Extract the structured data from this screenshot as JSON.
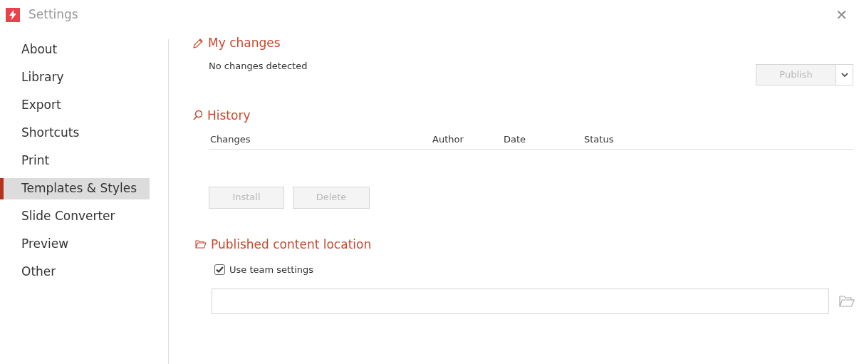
{
  "window": {
    "title": "Settings",
    "close": "✕"
  },
  "sidebar": {
    "items": [
      {
        "label": "About",
        "selected": false
      },
      {
        "label": "Library",
        "selected": false
      },
      {
        "label": "Export",
        "selected": false
      },
      {
        "label": "Shortcuts",
        "selected": false
      },
      {
        "label": "Print",
        "selected": false
      },
      {
        "label": "Templates & Styles",
        "selected": true
      },
      {
        "label": "Slide Converter",
        "selected": false
      },
      {
        "label": "Preview",
        "selected": false
      },
      {
        "label": "Other",
        "selected": false
      }
    ]
  },
  "my_changes": {
    "title": "My changes",
    "status": "No changes detected",
    "publish": {
      "label": "Publish",
      "disabled": true
    }
  },
  "history": {
    "title": "History",
    "columns": [
      "Changes",
      "Author",
      "Date",
      "Status"
    ],
    "buttons": [
      {
        "label": "Install",
        "disabled": true
      },
      {
        "label": "Delete",
        "disabled": true
      }
    ]
  },
  "published_location": {
    "title": "Published content location",
    "use_team_settings": {
      "label": "Use team settings",
      "checked": true
    }
  }
}
